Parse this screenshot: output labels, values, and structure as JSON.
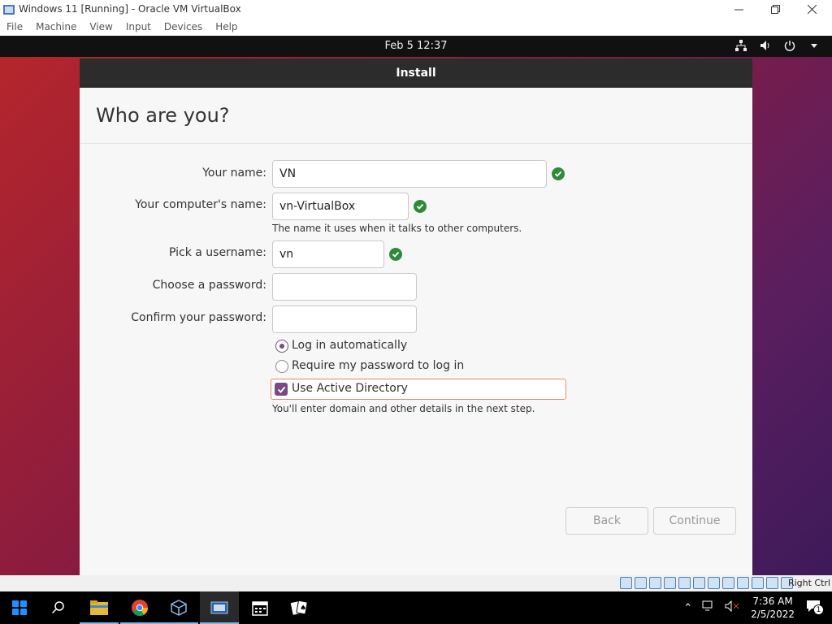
{
  "window": {
    "title": "Windows 11 [Running] - Oracle VM VirtualBox",
    "menu": [
      "File",
      "Machine",
      "View",
      "Input",
      "Devices",
      "Help"
    ]
  },
  "topbar": {
    "clock": "Feb 5  12:37"
  },
  "installer": {
    "header": "Install",
    "title": "Who are you?",
    "fields": {
      "name": {
        "label": "Your name:",
        "value": "VN"
      },
      "computer": {
        "label": "Your computer's name:",
        "value": "vn-VirtualBox",
        "hint": "The name it uses when it talks to other computers."
      },
      "username": {
        "label": "Pick a username:",
        "value": "vn"
      },
      "password": {
        "label": "Choose a password:",
        "value": ""
      },
      "confirm": {
        "label": "Confirm your password:",
        "value": ""
      }
    },
    "login_options": {
      "auto": "Log in automatically",
      "require": "Require my password to log in",
      "selected": "auto"
    },
    "active_directory": {
      "label": "Use Active Directory",
      "checked": true,
      "hint": "You'll enter domain and other details in the next step."
    },
    "buttons": {
      "back": "Back",
      "continue": "Continue"
    }
  },
  "statusbar": {
    "host_key": "Right Ctrl"
  },
  "taskbar": {
    "time": "7:36 AM",
    "date": "2/5/2022",
    "notification_count": "1",
    "apps": [
      "start-icon",
      "search-icon",
      "file-explorer-icon",
      "chrome-icon",
      "virtualbox-icon",
      "vm-window-icon",
      "calendar-icon",
      "solitaire-icon"
    ]
  },
  "colors": {
    "ubuntu_accent": "#7a4a85",
    "valid_check": "#2e8b3a",
    "focus_border": "#e7876a",
    "header_bg": "#2c2c2c"
  }
}
